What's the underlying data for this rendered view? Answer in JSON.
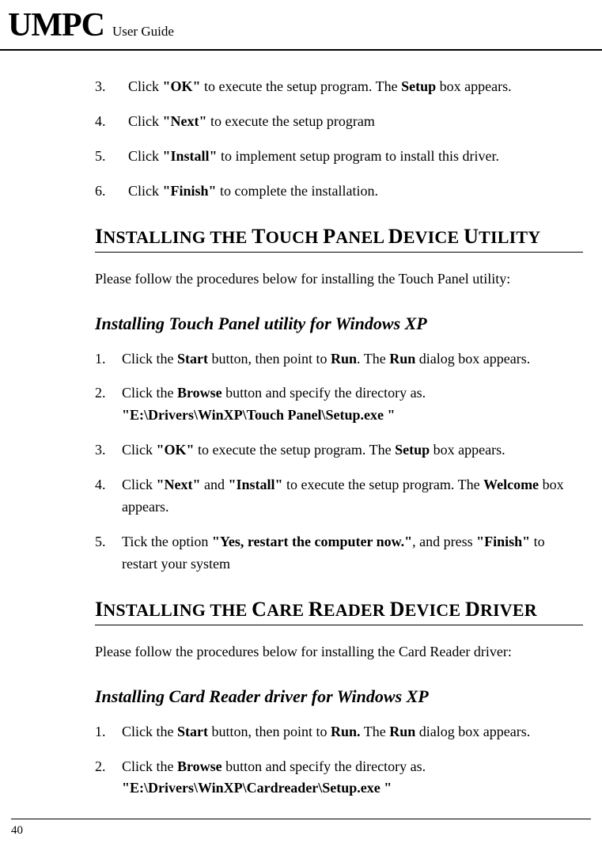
{
  "header": {
    "brand": "UMPC",
    "subtitle": "User Guide"
  },
  "top_steps": [
    {
      "n": "3.",
      "parts": [
        "Click ",
        "\"OK\"",
        " to execute the setup program. The ",
        "Setup",
        " box appears."
      ]
    },
    {
      "n": "4.",
      "parts": [
        "Click ",
        "\"Next\"",
        " to execute the setup program"
      ]
    },
    {
      "n": "5.",
      "parts": [
        "Click ",
        "\"Install\"",
        " to implement setup program to install this driver."
      ]
    },
    {
      "n": "6.",
      "parts": [
        "Click ",
        "\"Finish\"",
        " to complete the installation."
      ]
    }
  ],
  "section1": {
    "heading_parts": [
      "I",
      "NSTALLING THE ",
      "T",
      "OUCH ",
      "P",
      "ANEL ",
      "D",
      "EVICE ",
      "U",
      "TILITY"
    ],
    "intro": "Please follow the procedures below for installing the Touch Panel utility:",
    "subheading": "Installing Touch Panel utility for Windows XP",
    "steps": [
      {
        "n": "1.",
        "parts": [
          "Click the ",
          "Start",
          " button, then point to ",
          "Run",
          ". The ",
          "Run",
          " dialog box appears."
        ]
      },
      {
        "n": "2.",
        "parts": [
          "Click the ",
          "Browse",
          " button and specify the directory as. ",
          "\"E:\\Drivers\\WinXP\\Touch Panel\\Setup.exe \""
        ]
      },
      {
        "n": "3.",
        "parts": [
          "Click ",
          "\"OK\"",
          " to execute the setup program. The ",
          "Setup",
          " box appears."
        ]
      },
      {
        "n": "4.",
        "parts": [
          "Click ",
          "\"Next\"",
          " and ",
          "\"Install\"",
          " to execute the setup program. The ",
          "Welcome",
          " box appears."
        ]
      },
      {
        "n": "5.",
        "parts": [
          "Tick the option ",
          "\"Yes, restart the computer now.\"",
          ", and press ",
          "\"Finish\"",
          " to restart your system"
        ]
      }
    ]
  },
  "section2": {
    "heading_parts": [
      "I",
      "NSTALLING THE ",
      "C",
      "ARE ",
      "R",
      "EADER ",
      "D",
      "EVICE ",
      "D",
      "RIVER"
    ],
    "intro": "Please follow the procedures below for installing the Card Reader driver:",
    "subheading": "Installing Card Reader driver for Windows XP",
    "steps": [
      {
        "n": "1.",
        "parts": [
          "Click the ",
          "Start",
          " button, then point to ",
          "Run.",
          " The ",
          "Run",
          " dialog box appears."
        ]
      },
      {
        "n": "2.",
        "parts": [
          "Click the ",
          "Browse",
          " button and specify the directory as. ",
          "\"E:\\Drivers\\WinXP\\Cardreader\\Setup.exe \""
        ]
      }
    ]
  },
  "page_number": "40"
}
